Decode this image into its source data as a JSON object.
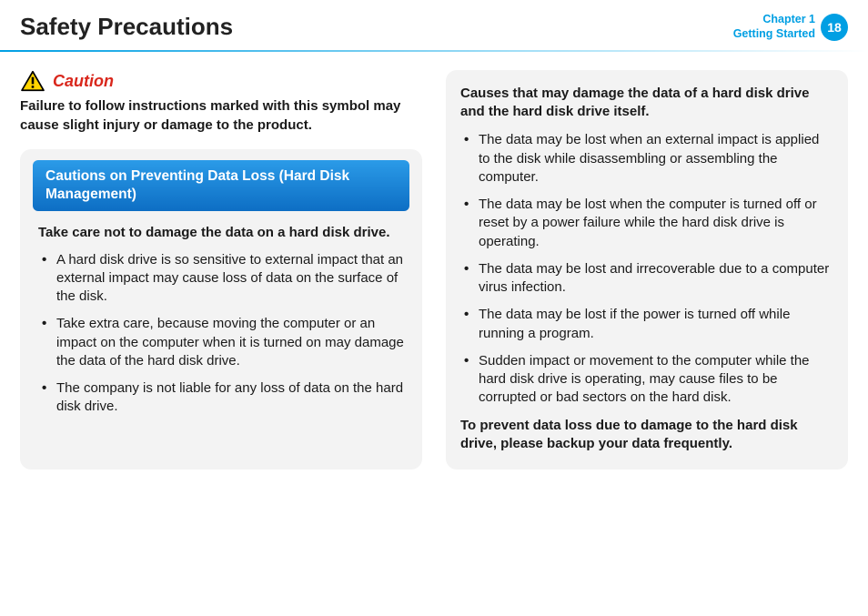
{
  "header": {
    "title": "Safety Precautions",
    "chapter_line1": "Chapter 1",
    "chapter_line2": "Getting Started",
    "page_number": "18"
  },
  "caution": {
    "label": "Caution",
    "text": "Failure to follow instructions marked with this symbol may cause slight injury or damage to the product."
  },
  "left_panel": {
    "banner": "Cautions on Preventing Data Loss (Hard Disk Management)",
    "subhead": "Take care not to damage the data on a hard disk drive.",
    "bullets": [
      "A hard disk drive is so sensitive to external impact that an external impact may cause loss of data on the surface of the disk.",
      "Take extra care, because moving the computer or an impact on the computer when it is turned on may damage the data of the hard disk drive.",
      "The company is not liable for any loss of data on the hard disk drive."
    ]
  },
  "right_panel": {
    "causes_head": "Causes that may damage the data of a hard disk drive and the hard disk drive itself.",
    "bullets": [
      "The data may be lost when an external impact is applied to the disk while disassembling or assembling the computer.",
      "The data may be lost when the computer is turned off or reset by a power failure while the hard disk drive is operating.",
      "The data may be lost and irrecoverable due to a computer virus infection.",
      "The data may be lost if the power is turned off while running a program.",
      "Sudden impact or movement to the computer while the hard disk drive is operating, may cause files to be corrupted or bad sectors on the hard disk."
    ],
    "closing": "To prevent data loss due to damage to the hard disk drive, please backup your data frequently."
  }
}
